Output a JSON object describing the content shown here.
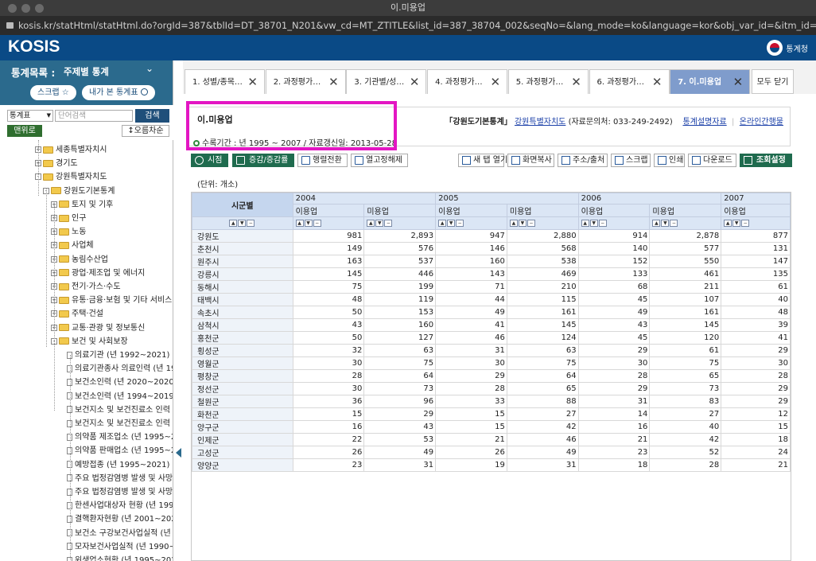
{
  "window": {
    "title": "이.미용업"
  },
  "url": "kosis.kr/statHtml/statHtml.do?orgId=387&tblId=DT_38701_N201&vw_cd=MT_ZTITLE&list_id=387_38704_002&seqNo=&lang_mode=ko&language=kor&obj_var_id=&itm_id=&conn_path=MT_ZTIT...",
  "header": {
    "logo": "KOSIS",
    "agency": "통계청"
  },
  "left": {
    "label": "통계목록 :",
    "category": "주제별 통계",
    "chevron": "⌄",
    "scrap_button": "스크랩 ☆",
    "my_stats_button": "내가 본 통계표",
    "search_select": "통계표",
    "search_placeholder": "단어검색",
    "search_button": "검색",
    "menu_button": "맨위로",
    "sort_button": "오름차순",
    "tree": [
      {
        "label": "세종특별자치시",
        "kind": "folder",
        "pm": "+"
      },
      {
        "label": "경기도",
        "kind": "folder",
        "pm": "+"
      },
      {
        "label": "강원특별자치도",
        "kind": "folder",
        "pm": "-"
      },
      {
        "label": "강원도기본통계",
        "kind": "folder",
        "pm": "-"
      },
      {
        "label": "토지 및 기후",
        "kind": "folder",
        "pm": "+"
      },
      {
        "label": "인구",
        "kind": "folder",
        "pm": "+"
      },
      {
        "label": "노동",
        "kind": "folder",
        "pm": "+"
      },
      {
        "label": "사업체",
        "kind": "folder",
        "pm": "+"
      },
      {
        "label": "농림수산업",
        "kind": "folder",
        "pm": "+"
      },
      {
        "label": "광업·제조업 및 에너지",
        "kind": "folder",
        "pm": "+"
      },
      {
        "label": "전기·가스·수도",
        "kind": "folder",
        "pm": "+"
      },
      {
        "label": "유통·금융·보험 및 기타 서비스",
        "kind": "folder",
        "pm": "+"
      },
      {
        "label": "주택·건설",
        "kind": "folder",
        "pm": "+"
      },
      {
        "label": "교통·관광 및 정보통신",
        "kind": "folder",
        "pm": "+"
      },
      {
        "label": "보건 및 사회보장",
        "kind": "folder",
        "pm": "-"
      },
      {
        "label": "의료기관 (년 1992~2021)",
        "kind": "doc"
      },
      {
        "label": "의료기관종사 의료인력 (년 19",
        "kind": "doc"
      },
      {
        "label": "보건소인력 (년 2020~2020)",
        "kind": "doc"
      },
      {
        "label": "보건소인력 (년 1994~2019)",
        "kind": "doc"
      },
      {
        "label": "보건지소 및 보건진료소 인력",
        "kind": "doc"
      },
      {
        "label": "보건지소 및 보건진료소 인력",
        "kind": "doc"
      },
      {
        "label": "의약품 제조업소 (년 1995~20",
        "kind": "doc"
      },
      {
        "label": "의약품 판매업소 (년 1995~20",
        "kind": "doc"
      },
      {
        "label": "예방접종 (년 1995~2021)",
        "kind": "doc"
      },
      {
        "label": "주요 법정감염병 발생 및 사망",
        "kind": "doc"
      },
      {
        "label": "주요 법정감염병 발생 및 사망",
        "kind": "doc"
      },
      {
        "label": "한센사업대상자 현황 (년 199",
        "kind": "doc"
      },
      {
        "label": "결핵환자현황 (년 2001~2020",
        "kind": "doc"
      },
      {
        "label": "보건소 구강보건사업실적 (년",
        "kind": "doc"
      },
      {
        "label": "모자보건사업실적 (년 1990~2",
        "kind": "doc"
      },
      {
        "label": "위생업소현황 (년 1995~2021)",
        "kind": "doc"
      }
    ]
  },
  "tabs": [
    {
      "label": "1. 성별/종목…",
      "active": false
    },
    {
      "label": "2. 과정평가…",
      "active": false
    },
    {
      "label": "3. 기관별/성…",
      "active": false
    },
    {
      "label": "4. 과정평가…",
      "active": false
    },
    {
      "label": "5. 과정평가…",
      "active": false
    },
    {
      "label": "6. 과정평가…",
      "active": false
    },
    {
      "label": "7. 이.미용업",
      "active": true
    }
  ],
  "close_all": "모두 닫기",
  "info": {
    "title": "이.미용업",
    "period": "수록기간 : 년 1995 ~ 2007 / 자료갱신일: 2013-05-28",
    "source_name": "「강원도기본통계」",
    "source_org": "강원특별자치도",
    "contact": "(자료문의처: 033-249-2492)",
    "desc_link": "통계설명자료",
    "online_link": "온라인간행물"
  },
  "toolbar": {
    "left": [
      {
        "label": "시점",
        "green": true
      },
      {
        "label": "증감/증감률",
        "green": true
      },
      {
        "label": "행렬전환",
        "green": false
      },
      {
        "label": "열고정해제",
        "green": false
      }
    ],
    "right": [
      {
        "label": "새 탭 열기"
      },
      {
        "label": "화면복사"
      },
      {
        "label": "주소/출처"
      },
      {
        "label": "스크랩"
      },
      {
        "label": "인쇄"
      },
      {
        "label": "다운로드"
      },
      {
        "label": "조회설정",
        "green": true
      }
    ]
  },
  "unit": "(단위: 개소)",
  "table": {
    "row_header": "시군별",
    "years": [
      "2004",
      "2005",
      "2006",
      "2007"
    ],
    "sub_headers": [
      "이용업",
      "미용업",
      "이용업",
      "미용업",
      "이용업",
      "미용업",
      "이용업"
    ],
    "rows": [
      {
        "name": "강원도",
        "values": [
          "981",
          "2,893",
          "947",
          "2,880",
          "914",
          "2,878",
          "877"
        ]
      },
      {
        "name": "춘천시",
        "values": [
          "149",
          "576",
          "146",
          "568",
          "140",
          "577",
          "131"
        ]
      },
      {
        "name": "원주시",
        "values": [
          "163",
          "537",
          "160",
          "538",
          "152",
          "550",
          "147"
        ]
      },
      {
        "name": "강릉시",
        "values": [
          "145",
          "446",
          "143",
          "469",
          "133",
          "461",
          "135"
        ]
      },
      {
        "name": "동해시",
        "values": [
          "75",
          "199",
          "71",
          "210",
          "68",
          "211",
          "61"
        ]
      },
      {
        "name": "태백시",
        "values": [
          "48",
          "119",
          "44",
          "115",
          "45",
          "107",
          "40"
        ]
      },
      {
        "name": "속초시",
        "values": [
          "50",
          "153",
          "49",
          "161",
          "49",
          "161",
          "48"
        ]
      },
      {
        "name": "삼척시",
        "values": [
          "43",
          "160",
          "41",
          "145",
          "43",
          "145",
          "39"
        ]
      },
      {
        "name": "홍천군",
        "values": [
          "50",
          "127",
          "46",
          "124",
          "45",
          "120",
          "41"
        ]
      },
      {
        "name": "횡성군",
        "values": [
          "32",
          "63",
          "31",
          "63",
          "29",
          "61",
          "29"
        ]
      },
      {
        "name": "영월군",
        "values": [
          "30",
          "75",
          "30",
          "75",
          "30",
          "75",
          "30"
        ]
      },
      {
        "name": "평창군",
        "values": [
          "28",
          "64",
          "29",
          "64",
          "28",
          "65",
          "28"
        ]
      },
      {
        "name": "정선군",
        "values": [
          "30",
          "73",
          "28",
          "65",
          "29",
          "73",
          "29"
        ]
      },
      {
        "name": "철원군",
        "values": [
          "36",
          "96",
          "33",
          "88",
          "31",
          "83",
          "29"
        ]
      },
      {
        "name": "화천군",
        "values": [
          "15",
          "29",
          "15",
          "27",
          "14",
          "27",
          "12"
        ]
      },
      {
        "name": "양구군",
        "values": [
          "16",
          "43",
          "15",
          "42",
          "16",
          "40",
          "15"
        ]
      },
      {
        "name": "인제군",
        "values": [
          "22",
          "53",
          "21",
          "46",
          "21",
          "42",
          "18"
        ]
      },
      {
        "name": "고성군",
        "values": [
          "26",
          "49",
          "26",
          "49",
          "23",
          "52",
          "24"
        ]
      },
      {
        "name": "양양군",
        "values": [
          "23",
          "31",
          "19",
          "31",
          "18",
          "28",
          "21"
        ]
      }
    ]
  }
}
